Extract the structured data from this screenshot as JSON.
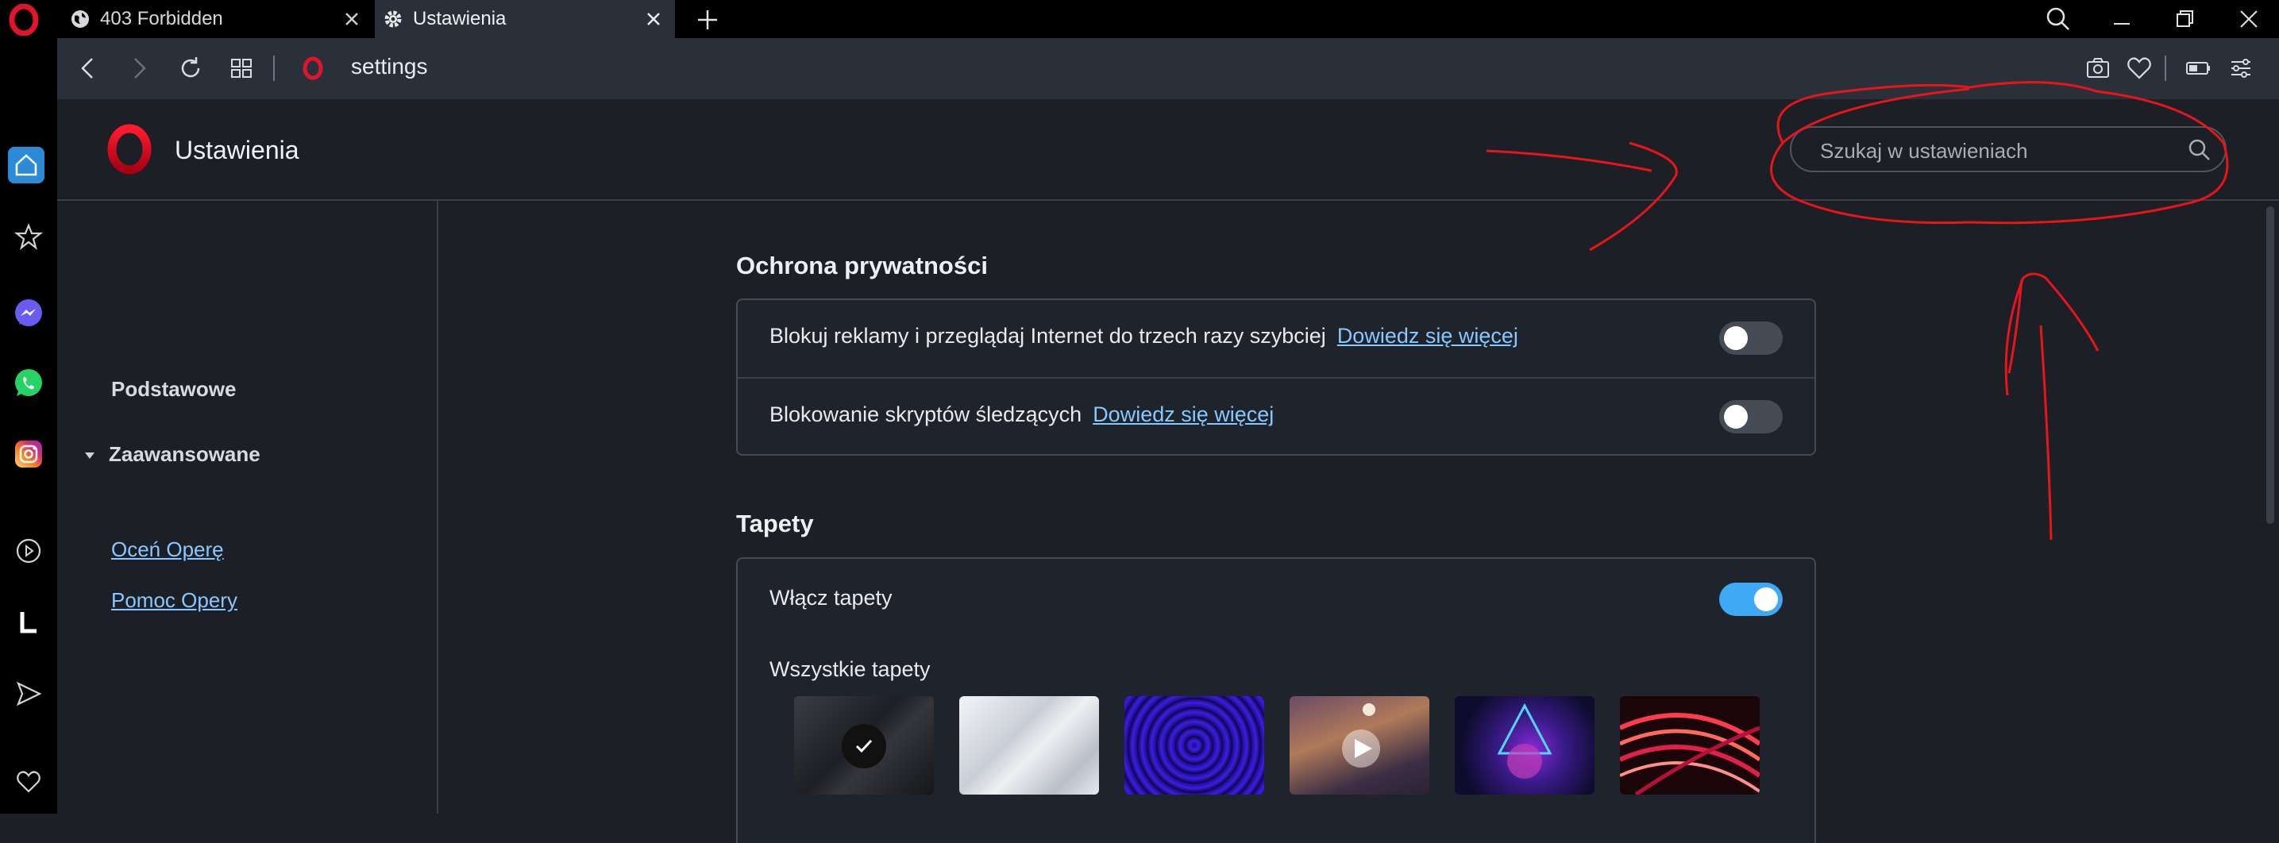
{
  "browser": {
    "tabs": [
      {
        "title": "403 Forbidden",
        "icon": "globe-icon"
      },
      {
        "title": "Ustawienia",
        "icon": "gear-icon",
        "active": true
      }
    ],
    "address": "settings"
  },
  "settings": {
    "page_title": "Ustawienia",
    "search_placeholder": "Szukaj w ustawieniach",
    "nav": {
      "basic": "Podstawowe",
      "advanced": "Zaawansowane",
      "rate": "Oceń Operę",
      "help": "Pomoc Opery"
    },
    "privacy": {
      "title": "Ochrona prywatności",
      "rows": [
        {
          "label": "Blokuj reklamy i przeglądaj Internet do trzech razy szybciej",
          "link": "Dowiedz się więcej",
          "enabled": false
        },
        {
          "label": "Blokowanie skryptów śledzących",
          "link": "Dowiedz się więcej",
          "enabled": false
        }
      ]
    },
    "wallpapers": {
      "title": "Tapety",
      "enable_label": "Włącz tapety",
      "enabled": true,
      "all_label": "Wszystkie tapety",
      "thumbs": [
        "dark-waves",
        "light-waves",
        "purple-tunnel",
        "illustrated-room",
        "neon-triangle",
        "red-swirls"
      ],
      "selected_index": 0
    }
  },
  "colors": {
    "accent": "#3fa9f5",
    "link": "#86c8ff",
    "opera_red": "#e0152b",
    "annotation_red": "#e8141c"
  }
}
